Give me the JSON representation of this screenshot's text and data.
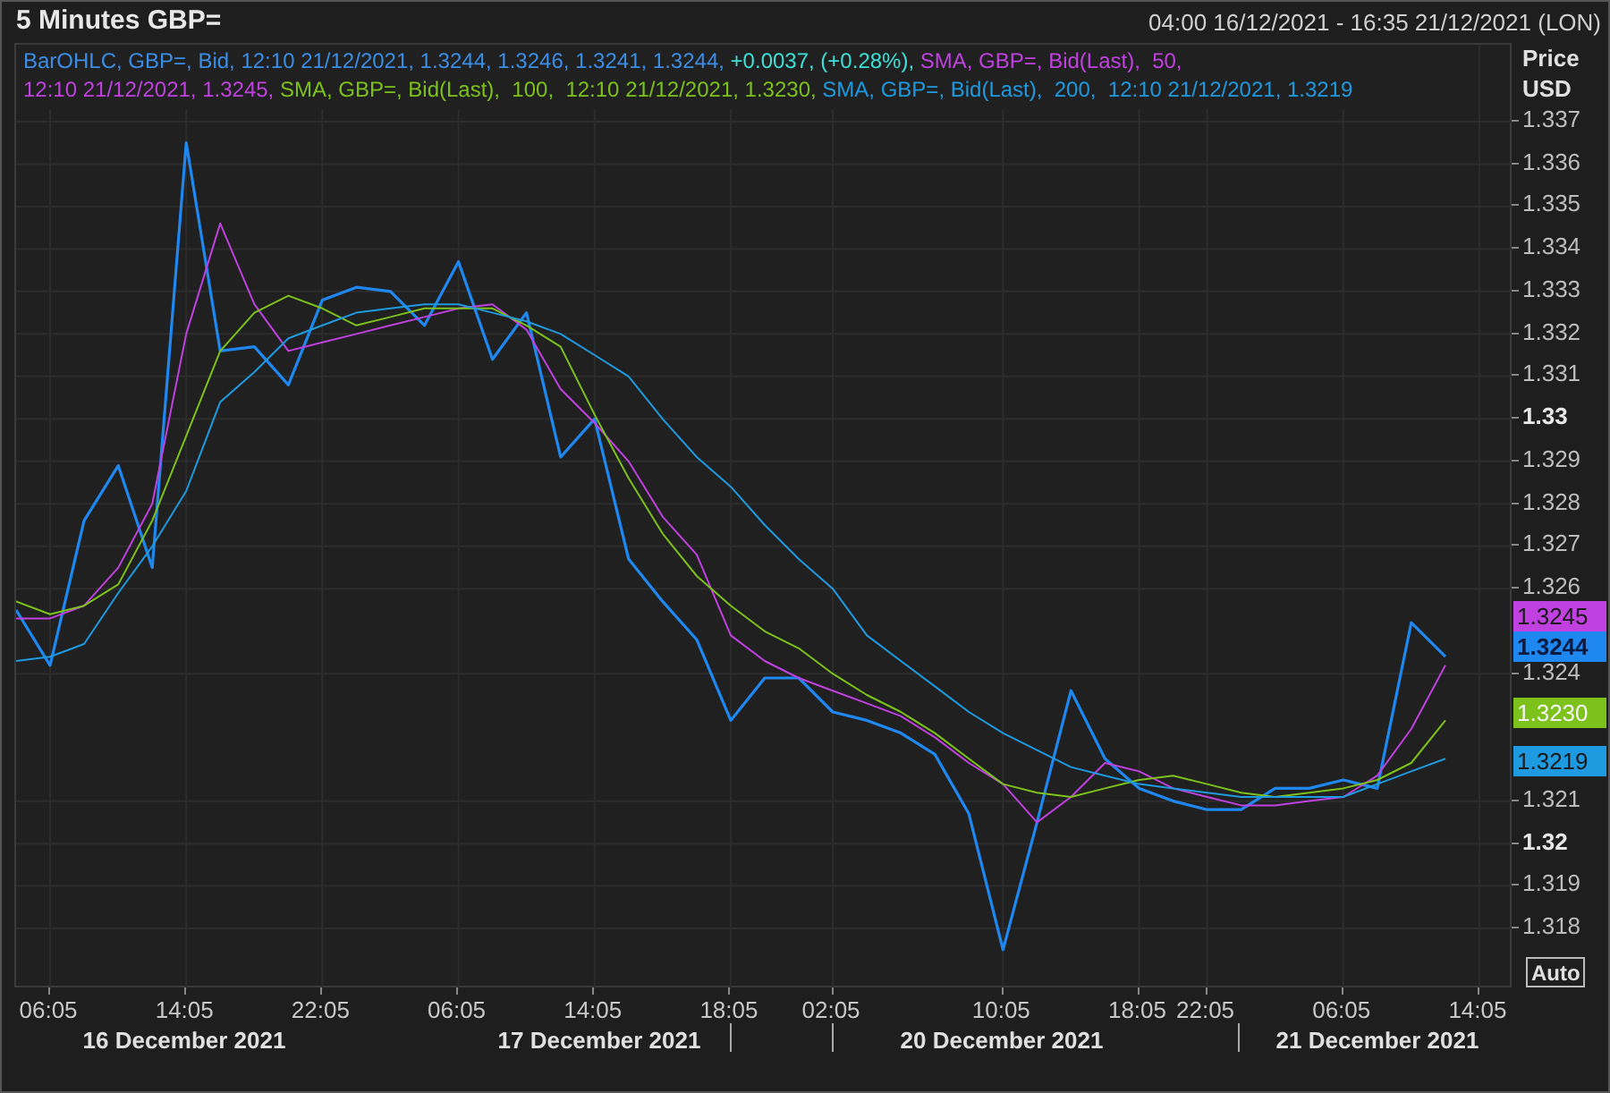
{
  "header": {
    "title": "5 Minutes GBP=",
    "range": "04:00 16/12/2021 - 16:35 21/12/2021 (LON)"
  },
  "legend": {
    "lines": [
      [
        {
          "text": "BarOHLC, GBP=, Bid, 12:10 21/12/2021, 1.3244, 1.3246, 1.3241, 1.3244, ",
          "color": "#3a8ee6"
        },
        {
          "text": "+0.0037, (+0.28%), ",
          "color": "#3ee0d8"
        },
        {
          "text": "SMA, GBP=, Bid(Last),  50,",
          "color": "#c040e0"
        }
      ],
      [
        {
          "text": "12:10 21/12/2021, 1.3245, ",
          "color": "#c040e0"
        },
        {
          "text": "SMA, GBP=, Bid(Last),  100,  12:10 21/12/2021, 1.3230, ",
          "color": "#7cc21a"
        },
        {
          "text": "SMA, GBP=, Bid(Last),  200,  12:10 21/12/2021, 1.3219",
          "color": "#1e9ae0"
        }
      ]
    ]
  },
  "axis_title": [
    "Price",
    "USD"
  ],
  "chart_data": {
    "type": "line",
    "grid": true,
    "ylim": [
      1.31657,
      1.33881
    ],
    "categories": [
      null,
      "06:05",
      null,
      null,
      null,
      "14:05",
      null,
      null,
      null,
      "22:05",
      null,
      null,
      null,
      "06:05",
      null,
      null,
      null,
      "14:05",
      null,
      null,
      null,
      "18:05",
      null,
      null,
      "02:05",
      null,
      null,
      null,
      null,
      "10:05",
      null,
      null,
      null,
      "18:05",
      null,
      "22:05",
      null,
      null,
      null,
      "06:05",
      null,
      null,
      null,
      "14:05",
      null
    ],
    "yticks": [
      {
        "value": 1.337,
        "label": "1.337"
      },
      {
        "value": 1.336,
        "label": "1.336"
      },
      {
        "value": 1.335,
        "label": "1.335"
      },
      {
        "value": 1.334,
        "label": "1.334"
      },
      {
        "value": 1.333,
        "label": "1.333"
      },
      {
        "value": 1.332,
        "label": "1.332"
      },
      {
        "value": 1.331,
        "label": "1.331"
      },
      {
        "value": 1.33,
        "label": "1.33"
      },
      {
        "value": 1.329,
        "label": "1.329"
      },
      {
        "value": 1.328,
        "label": "1.328"
      },
      {
        "value": 1.327,
        "label": "1.327"
      },
      {
        "value": 1.326,
        "label": "1.326"
      },
      {
        "value": 1.324,
        "label": "1.324"
      },
      {
        "value": 1.321,
        "label": "1.321"
      },
      {
        "value": 1.32,
        "label": "1.32"
      },
      {
        "value": 1.319,
        "label": "1.319"
      },
      {
        "value": 1.318,
        "label": "1.318"
      }
    ],
    "series": [
      {
        "color": "#1e88f0",
        "values": [
          1.3255,
          1.3242,
          1.3276,
          1.3289,
          1.3265,
          1.3365,
          1.3316,
          1.3317,
          1.3308,
          1.3328,
          1.3331,
          1.333,
          1.3322,
          1.3337,
          1.3314,
          1.3325,
          1.3291,
          1.33,
          1.3267,
          1.3257,
          1.3248,
          1.3229,
          1.3239,
          1.3239,
          1.3231,
          1.3229,
          1.3226,
          1.3221,
          1.3207,
          1.3175,
          1.3205,
          1.3236,
          1.322,
          1.3213,
          1.321,
          1.3208,
          1.3208,
          1.3213,
          1.3213,
          1.3215,
          1.3213,
          1.3252,
          1.3244,
          null,
          null
        ]
      },
      {
        "color": "#c040e0",
        "values": [
          1.3253,
          1.3253,
          1.3256,
          1.3265,
          1.328,
          1.332,
          1.3346,
          1.3327,
          1.3316,
          1.3318,
          1.332,
          1.3322,
          1.3324,
          1.3326,
          1.3327,
          1.3321,
          1.3307,
          1.3299,
          1.329,
          1.3277,
          1.3268,
          1.3249,
          1.3243,
          1.3239,
          1.3236,
          1.3233,
          1.323,
          1.3225,
          1.3219,
          1.3214,
          1.3205,
          1.3211,
          1.3219,
          1.3217,
          1.3213,
          1.3211,
          1.3209,
          1.3209,
          1.321,
          1.3211,
          1.3216,
          1.3227,
          1.3242,
          null,
          null
        ]
      },
      {
        "color": "#7cc21a",
        "values": [
          1.3257,
          1.3254,
          1.3256,
          1.3261,
          1.3276,
          1.3296,
          1.3316,
          1.3325,
          1.3329,
          1.3326,
          1.3322,
          1.3324,
          1.3326,
          1.3326,
          1.3326,
          1.3322,
          1.3317,
          1.3301,
          1.3286,
          1.3273,
          1.3263,
          1.3256,
          1.325,
          1.3246,
          1.324,
          1.3235,
          1.3231,
          1.3226,
          1.322,
          1.3214,
          1.3212,
          1.3211,
          1.3213,
          1.3215,
          1.3216,
          1.3214,
          1.3212,
          1.3211,
          1.3212,
          1.3213,
          1.3215,
          1.3219,
          1.3229,
          null,
          null
        ]
      },
      {
        "color": "#1e9ae0",
        "values": [
          1.3243,
          1.3244,
          1.3247,
          1.3259,
          1.327,
          1.3283,
          1.3304,
          1.3311,
          1.3319,
          1.3322,
          1.3325,
          1.3326,
          1.3327,
          1.3327,
          1.3325,
          1.3323,
          1.332,
          1.3315,
          1.331,
          1.33,
          1.3291,
          1.3284,
          1.3275,
          1.3267,
          1.326,
          1.3249,
          1.3243,
          1.3237,
          1.3231,
          1.3226,
          1.3222,
          1.3218,
          1.3216,
          1.3214,
          1.3213,
          1.3212,
          1.3211,
          1.3211,
          1.3211,
          1.3211,
          1.3214,
          1.3217,
          1.322,
          null,
          null
        ]
      }
    ]
  },
  "price_badges": [
    {
      "text": "1.3245",
      "color": "#c040e0"
    },
    {
      "text": "1.3244",
      "color": "#1e88f0"
    },
    {
      "text": "1.3230",
      "color": "#7cc21a"
    },
    {
      "text": "1.3219",
      "color": "#1e9ae0"
    }
  ],
  "auto_button": "Auto",
  "date_labels": [
    "16 December 2021",
    "17 December 2021",
    "20 December 2021",
    "21 December 2021"
  ]
}
